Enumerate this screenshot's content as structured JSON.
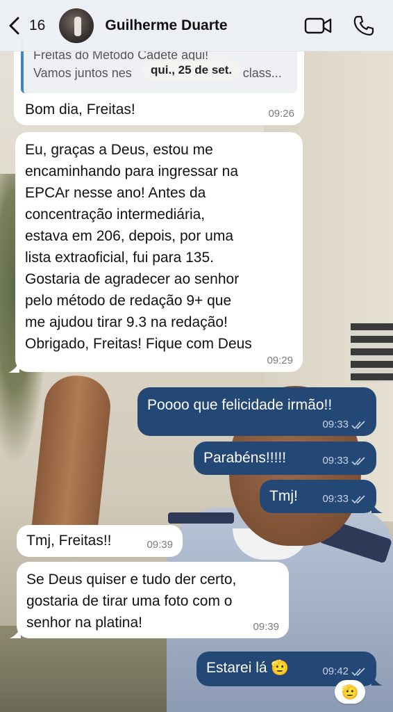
{
  "header": {
    "back_count": "16",
    "contact_name": "Guilherme Duarte"
  },
  "date_separator": "qui., 25 de set.",
  "quoted_message": {
    "line1": "Freitas do Método Cadete aqui!",
    "line2": "Vamos juntos nes",
    "line2_end": "class..."
  },
  "messages": [
    {
      "id": "m1",
      "direction": "in",
      "text": "Bom dia, Freitas!",
      "time": "09:26"
    },
    {
      "id": "m2",
      "direction": "in",
      "lines": [
        "Eu, graças a Deus, estou me",
        "encaminhando para ingressar na",
        "EPCAr nesse ano! Antes da",
        "concentração intermediária,",
        "estava em 206, depois, por uma",
        "lista extraoficial, fui para 135.",
        "Gostaria de agradecer ao senhor",
        "pelo método de redação 9+ que",
        "me ajudou tirar 9.3 na redação!",
        "Obrigado, Freitas! Fique com Deus"
      ],
      "time": "09:29"
    },
    {
      "id": "m3",
      "direction": "out",
      "text": "Poooo que felicidade irmão!!",
      "time": "09:33"
    },
    {
      "id": "m4",
      "direction": "out",
      "text": "Parabéns!!!!!",
      "time": "09:33"
    },
    {
      "id": "m5",
      "direction": "out",
      "text": "Tmj!",
      "time": "09:33"
    },
    {
      "id": "m6",
      "direction": "in",
      "text": "Tmj, Freitas!!",
      "time": "09:39"
    },
    {
      "id": "m7",
      "direction": "in",
      "lines": [
        "Se Deus quiser e tudo der certo,",
        "gostaria de tirar uma foto com o",
        "senhor na platina!"
      ],
      "time": "09:39"
    },
    {
      "id": "m8",
      "direction": "out",
      "text": "Estarei lá",
      "emoji": "🫡",
      "time": "09:42"
    }
  ],
  "reaction_emoji": "🫡",
  "colors": {
    "outgoing_bubble": "#244876",
    "incoming_bubble": "#ffffff",
    "header_bg": "#ecf0f6",
    "quote_bar": "#3a86c9"
  },
  "icons": [
    "back-chevron-icon",
    "video-call-icon",
    "phone-call-icon",
    "double-check-icon"
  ]
}
